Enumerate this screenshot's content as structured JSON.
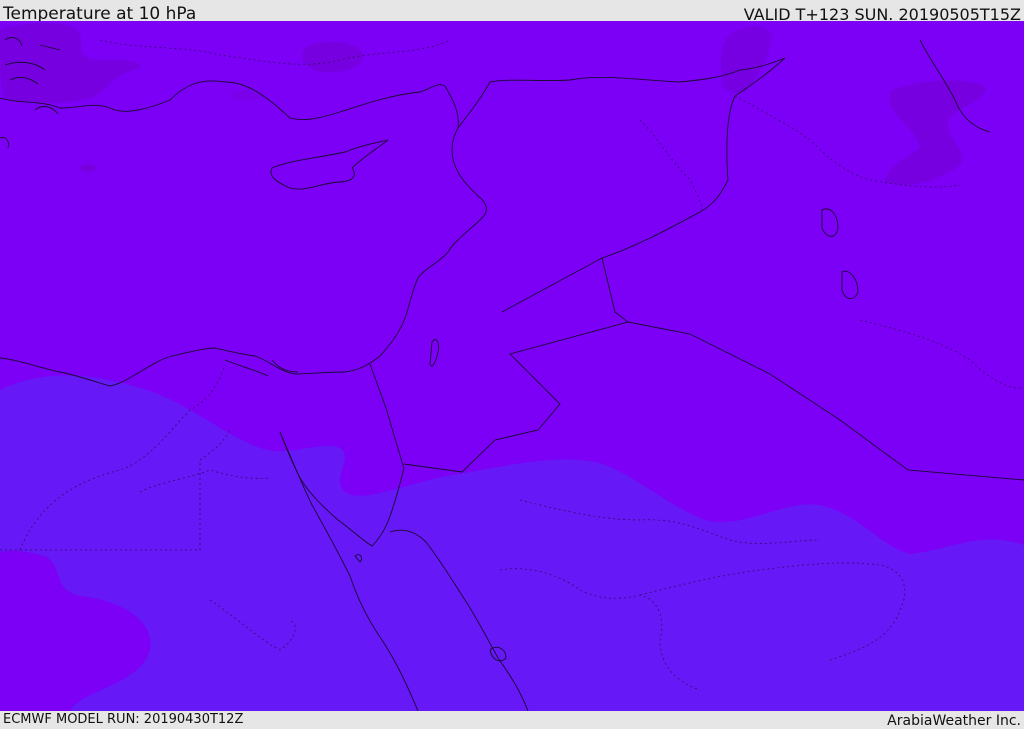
{
  "header": {
    "title": "Temperature at 10 hPa",
    "valid": "VALID T+123 SUN. 20190505T15Z"
  },
  "footer": {
    "model_run": "ECMWF MODEL RUN: 20190430T12Z",
    "credit": "ArabiaWeather Inc."
  },
  "map": {
    "region": "Eastern Mediterranean and Middle East",
    "colors": {
      "warm_field": "#7c00f6",
      "cool_field": "#6618f6",
      "warm_patch": "#7500dc",
      "mid_patch": "#7a00e8",
      "borders": "#1a0a33"
    }
  }
}
